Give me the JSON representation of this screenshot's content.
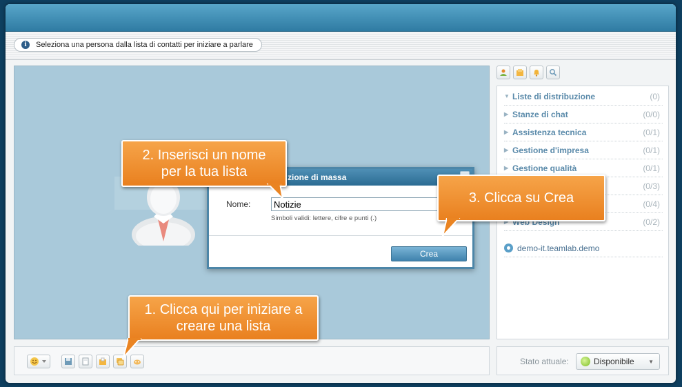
{
  "info_bar": {
    "message": "Seleziona una persona dalla lista di contatti per iniziare a parlare"
  },
  "contacts": {
    "groups": [
      {
        "label": "Liste di distribuzione",
        "count": "(0)",
        "expanded": true
      },
      {
        "label": "Stanze di chat",
        "count": "(0/0)",
        "expanded": false
      },
      {
        "label": "Assistenza tecnica",
        "count": "(0/1)",
        "expanded": false
      },
      {
        "label": "Gestione d'impresa",
        "count": "(0/1)",
        "expanded": false
      },
      {
        "label": "Gestione qualità",
        "count": "(0/1)",
        "expanded": false
      },
      {
        "label": "",
        "count": "(0/3)",
        "expanded": false
      },
      {
        "label": "",
        "count": "(0/4)",
        "expanded": false
      },
      {
        "label": "Web Design",
        "count": "(0/2)",
        "expanded": false
      }
    ],
    "server": "demo-it.teamlab.demo"
  },
  "dialog": {
    "title": "zione di massa",
    "name_label": "Nome:",
    "name_value": "Notizie",
    "hint": "Simboli validi: lettere, cifre e punti (.)",
    "create_label": "Crea"
  },
  "status": {
    "label": "Stato attuale:",
    "value": "Disponibile"
  },
  "callouts": {
    "step1": "1. Clicca qui per iniziare a creare una lista",
    "step2": "2. Inserisci un nome per la tua lista",
    "step3": "3. Clicca su Crea"
  },
  "colors": {
    "background": "#0e3f5f",
    "title_bar": "#3a8ab3",
    "callout": "#ee8a2a",
    "chat_area": "#a9c9da"
  }
}
